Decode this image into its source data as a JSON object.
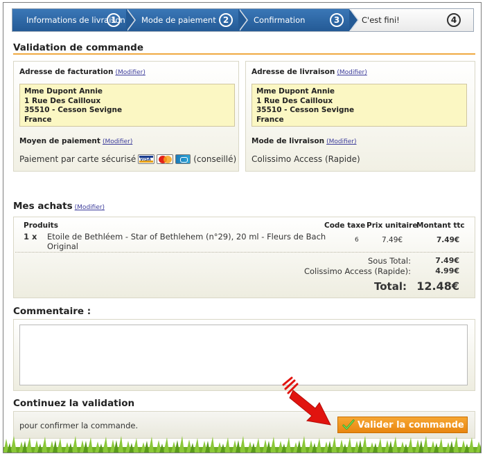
{
  "steps": [
    {
      "label": "Informations de livraison",
      "num": "1"
    },
    {
      "label": "Mode de paiement",
      "num": "2"
    },
    {
      "label": "Confirmation",
      "num": "3"
    },
    {
      "label": "C'est fini!",
      "num": "4"
    }
  ],
  "validation": {
    "title": "Validation de commande",
    "modify_label": "(Modifier)",
    "billing": {
      "title": "Adresse de facturation",
      "lines": [
        "Mme Dupont Annie",
        "1 Rue Des Cailloux",
        "35510 - Cesson Sevigne",
        "France"
      ]
    },
    "shipping": {
      "title": "Adresse de livraison",
      "lines": [
        "Mme Dupont Annie",
        "1 Rue Des Cailloux",
        "35510 - Cesson Sevigne",
        "France"
      ]
    },
    "payment": {
      "title": "Moyen de paiement",
      "value": "Paiement par carte sécurisé",
      "suffix": "(conseillé)",
      "cards": [
        "visa-icon",
        "mastercard-icon",
        "carte-bleue-icon"
      ]
    },
    "delivery": {
      "title": "Mode de livraison",
      "value": "Colissimo Access (Rapide)"
    }
  },
  "purchases": {
    "title": "Mes achats",
    "modify_label": "(Modifier)",
    "headers": {
      "products": "Produits",
      "tax_code": "Code taxe",
      "unit_price": "Prix unitaire",
      "amount": "Montant ttc"
    },
    "items": [
      {
        "qty": "1 x",
        "name_line1": "Etoile de Bethléem - Star of Bethlehem (n°29), 20 ml - Fleurs de Bach",
        "name_line2": "Original",
        "tax_code": "6",
        "unit_price": "7.49€",
        "amount": "7.49€"
      }
    ],
    "subtotal_label": "Sous Total:",
    "subtotal_value": "7.49€",
    "shipping_label": "Colissimo Access (Rapide):",
    "shipping_value": "4.99€",
    "total_label": "Total:",
    "total_value": "12.48€"
  },
  "comment": {
    "title": "Commentaire :",
    "value": ""
  },
  "continue": {
    "title": "Continuez la validation",
    "text": "pour confirmer la commande.",
    "button_label": "Valider la commande"
  },
  "colors": {
    "accent": "#f0a940",
    "step_active": "#2f6aa8",
    "button": "#ef9620",
    "arrow": "#e1140f"
  }
}
